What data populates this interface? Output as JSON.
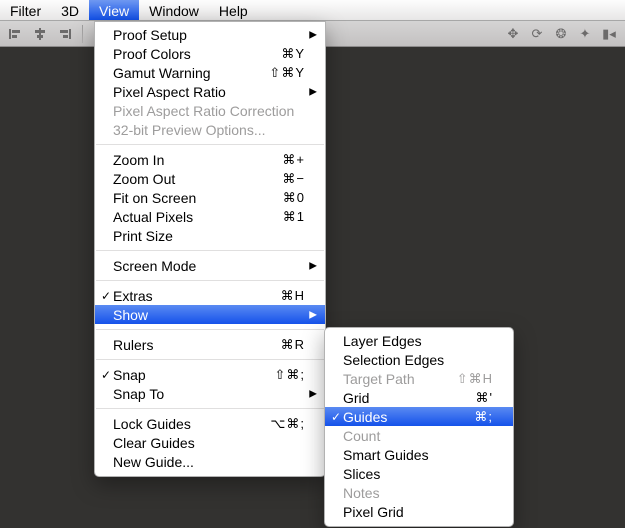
{
  "menubar": {
    "items": [
      {
        "label": "Filter",
        "selected": false
      },
      {
        "label": "3D",
        "selected": false
      },
      {
        "label": "View",
        "selected": true
      },
      {
        "label": "Window",
        "selected": false
      },
      {
        "label": "Help",
        "selected": false
      }
    ]
  },
  "toolbar_icons": [
    "align-left",
    "align-center",
    "align-right",
    "sep",
    "arrange-a",
    "arrange-b",
    "sep",
    "move-tool",
    "hand-tool",
    "rotate-view",
    "sep",
    "zoom",
    "orbit",
    "pan-3d",
    "camera"
  ],
  "view_menu": {
    "groups": [
      [
        {
          "label": "Proof Setup",
          "submenu": true
        },
        {
          "label": "Proof Colors",
          "shortcut": "⌘Y"
        },
        {
          "label": "Gamut Warning",
          "shortcut": "⇧⌘Y"
        },
        {
          "label": "Pixel Aspect Ratio",
          "submenu": true
        },
        {
          "label": "Pixel Aspect Ratio Correction",
          "disabled": true
        },
        {
          "label": "32-bit Preview Options...",
          "disabled": true
        }
      ],
      [
        {
          "label": "Zoom In",
          "shortcut": "⌘+"
        },
        {
          "label": "Zoom Out",
          "shortcut": "⌘−"
        },
        {
          "label": "Fit on Screen",
          "shortcut": "⌘0"
        },
        {
          "label": "Actual Pixels",
          "shortcut": "⌘1"
        },
        {
          "label": "Print Size"
        }
      ],
      [
        {
          "label": "Screen Mode",
          "submenu": true
        }
      ],
      [
        {
          "label": "Extras",
          "checked": true,
          "shortcut": "⌘H"
        },
        {
          "label": "Show",
          "submenu": true,
          "highlight": true
        }
      ],
      [
        {
          "label": "Rulers",
          "shortcut": "⌘R"
        }
      ],
      [
        {
          "label": "Snap",
          "checked": true,
          "shortcut": "⇧⌘;"
        },
        {
          "label": "Snap To",
          "submenu": true
        }
      ],
      [
        {
          "label": "Lock Guides",
          "shortcut": "⌥⌘;"
        },
        {
          "label": "Clear Guides"
        },
        {
          "label": "New Guide..."
        }
      ]
    ]
  },
  "show_submenu": {
    "items": [
      {
        "label": "Layer Edges"
      },
      {
        "label": "Selection Edges"
      },
      {
        "label": "Target Path",
        "shortcut": "⇧⌘H",
        "disabled": true
      },
      {
        "label": "Grid",
        "shortcut": "⌘'"
      },
      {
        "label": "Guides",
        "shortcut": "⌘;",
        "checked": true,
        "highlight": true
      },
      {
        "label": "Count",
        "disabled": true
      },
      {
        "label": "Smart Guides"
      },
      {
        "label": "Slices"
      },
      {
        "label": "Notes",
        "disabled": true
      },
      {
        "label": "Pixel Grid"
      }
    ]
  }
}
